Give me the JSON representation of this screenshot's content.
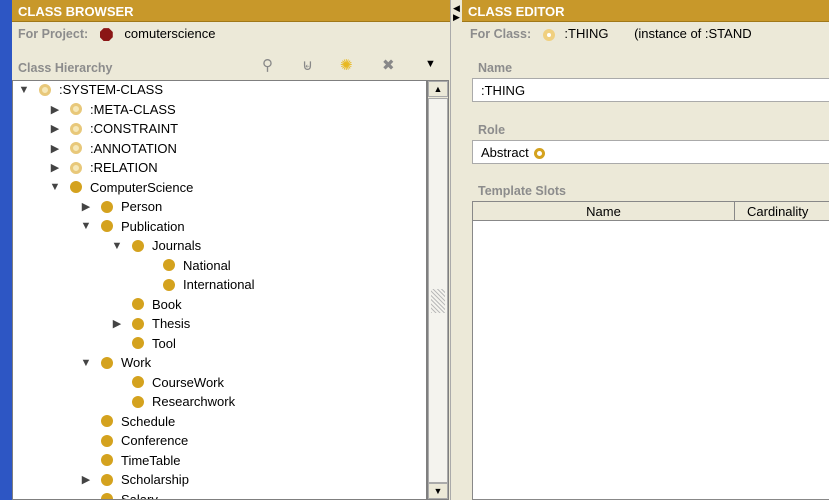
{
  "browser": {
    "title": "CLASS BROWSER",
    "project_label": "For Project:",
    "project_name": "comuterscience",
    "hierarchy_label": "Class Hierarchy",
    "tools": [
      "find-class-icon",
      "add-superclass-icon",
      "create-class-icon",
      "delete-class-icon",
      "menu-dropdown-icon"
    ],
    "tree": [
      {
        "label": ":SYSTEM-CLASS",
        "level": 0,
        "toggle": "expanded",
        "kind": "system"
      },
      {
        "label": ":META-CLASS",
        "level": 1,
        "toggle": "collapsed",
        "kind": "system"
      },
      {
        "label": ":CONSTRAINT",
        "level": 1,
        "toggle": "collapsed",
        "kind": "system"
      },
      {
        "label": ":ANNOTATION",
        "level": 1,
        "toggle": "collapsed",
        "kind": "system"
      },
      {
        "label": ":RELATION",
        "level": 1,
        "toggle": "collapsed",
        "kind": "system"
      },
      {
        "label": "ComputerScience",
        "level": 1,
        "toggle": "expanded",
        "kind": "class"
      },
      {
        "label": "Person",
        "level": 2,
        "toggle": "collapsed",
        "kind": "class"
      },
      {
        "label": "Publication",
        "level": 2,
        "toggle": "expanded",
        "kind": "class"
      },
      {
        "label": "Journals",
        "level": 3,
        "toggle": "expanded",
        "kind": "class"
      },
      {
        "label": "National",
        "level": 4,
        "toggle": "",
        "kind": "class"
      },
      {
        "label": "International",
        "level": 4,
        "toggle": "",
        "kind": "class"
      },
      {
        "label": "Book",
        "level": 3,
        "toggle": "",
        "kind": "class"
      },
      {
        "label": "Thesis",
        "level": 3,
        "toggle": "collapsed",
        "kind": "class"
      },
      {
        "label": "Tool",
        "level": 3,
        "toggle": "",
        "kind": "class"
      },
      {
        "label": "Work",
        "level": 2,
        "toggle": "expanded",
        "kind": "class"
      },
      {
        "label": "CourseWork",
        "level": 3,
        "toggle": "",
        "kind": "class"
      },
      {
        "label": "Researchwork",
        "level": 3,
        "toggle": "",
        "kind": "class"
      },
      {
        "label": "Schedule",
        "level": 2,
        "toggle": "",
        "kind": "class"
      },
      {
        "label": "Conference",
        "level": 2,
        "toggle": "",
        "kind": "class"
      },
      {
        "label": "TimeTable",
        "level": 2,
        "toggle": "",
        "kind": "class"
      },
      {
        "label": "Scholarship",
        "level": 2,
        "toggle": "collapsed",
        "kind": "class"
      },
      {
        "label": "Salary",
        "level": 2,
        "toggle": "",
        "kind": "class"
      }
    ]
  },
  "editor": {
    "title": "CLASS EDITOR",
    "for_class_label": "For Class:",
    "class_name": ":THING",
    "instance_of": "(instance of :STAND",
    "name_label": "Name",
    "name_value": ":THING",
    "role_label": "Role",
    "role_value": "Abstract",
    "slots_label": "Template Slots",
    "columns": [
      "Name",
      "Cardinality"
    ]
  },
  "colors": {
    "header": "#c8982a",
    "class_icon": "#d4a21e",
    "project_icon": "#8b1616"
  }
}
